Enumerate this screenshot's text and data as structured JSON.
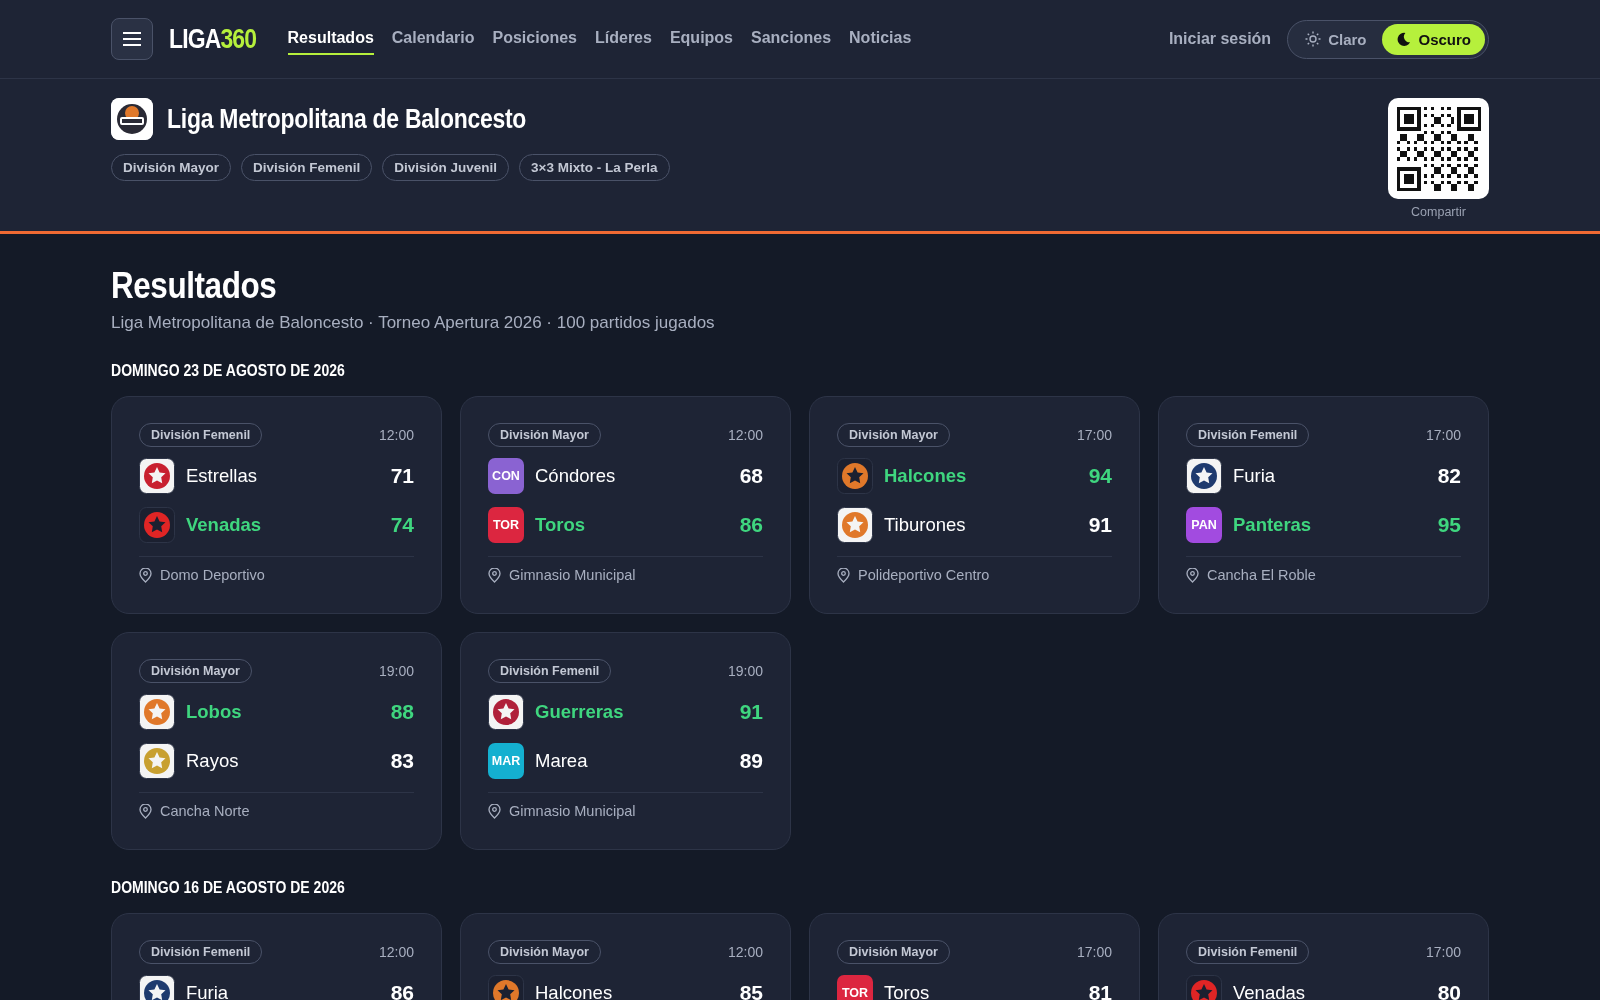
{
  "nav": {
    "brand": {
      "main": "LIGA",
      "accent": "360"
    },
    "links": [
      {
        "label": "Resultados",
        "selected": true
      },
      {
        "label": "Calendario",
        "selected": false
      },
      {
        "label": "Posiciones",
        "selected": false
      },
      {
        "label": "Líderes",
        "selected": false
      },
      {
        "label": "Equipos",
        "selected": false
      },
      {
        "label": "Sanciones",
        "selected": false
      },
      {
        "label": "Noticias",
        "selected": false
      }
    ],
    "login": "Iniciar sesión",
    "theme": [
      {
        "label": "Claro",
        "kind": "sun",
        "selected": false
      },
      {
        "label": "Oscuro",
        "kind": "moon",
        "selected": true
      }
    ]
  },
  "league": {
    "name": "Liga Metropolitana de Baloncesto",
    "divisions": [
      "División Mayor",
      "División Femenil",
      "División Juvenil",
      "3×3 Mixto - La Perla"
    ],
    "share": "Compartir"
  },
  "page": {
    "title": "Resultados",
    "subtitle": "Liga Metropolitana de Baloncesto · Torneo Apertura 2026 · 100 partidos jugados"
  },
  "days": [
    {
      "date": "DOMINGO 23 DE AGOSTO DE 2026",
      "matches": [
        {
          "division": "División Femenil",
          "time": "12:00",
          "venue": "Domo Deportivo",
          "teams": [
            {
              "name": "Estrellas",
              "score": "71",
              "winner": false,
              "logo": {
                "kind": "emblem",
                "color": "#c8202f",
                "light": true
              }
            },
            {
              "name": "Venadas",
              "score": "74",
              "winner": true,
              "logo": {
                "kind": "emblem",
                "color": "#e02525",
                "light": false
              }
            }
          ]
        },
        {
          "division": "División Mayor",
          "time": "12:00",
          "venue": "Gimnasio Municipal",
          "teams": [
            {
              "name": "Cóndores",
              "score": "68",
              "winner": false,
              "logo": {
                "kind": "abbr",
                "text": "CON",
                "color": "#8a63d2"
              }
            },
            {
              "name": "Toros",
              "score": "86",
              "winner": true,
              "logo": {
                "kind": "abbr",
                "text": "TOR",
                "color": "#dc2640"
              }
            }
          ]
        },
        {
          "division": "División Mayor",
          "time": "17:00",
          "venue": "Polideportivo Centro",
          "teams": [
            {
              "name": "Halcones",
              "score": "94",
              "winner": true,
              "logo": {
                "kind": "emblem",
                "color": "#e0782a",
                "light": false
              }
            },
            {
              "name": "Tiburones",
              "score": "91",
              "winner": false,
              "logo": {
                "kind": "emblem",
                "color": "#e0782a",
                "light": true
              }
            }
          ]
        },
        {
          "division": "División Femenil",
          "time": "17:00",
          "venue": "Cancha El Roble",
          "teams": [
            {
              "name": "Furia",
              "score": "82",
              "winner": false,
              "logo": {
                "kind": "emblem",
                "color": "#1e3a6e",
                "light": true
              }
            },
            {
              "name": "Panteras",
              "score": "95",
              "winner": true,
              "logo": {
                "kind": "abbr",
                "text": "PAN",
                "color": "#a24be0"
              }
            }
          ]
        },
        {
          "division": "División Mayor",
          "time": "19:00",
          "venue": "Cancha Norte",
          "teams": [
            {
              "name": "Lobos",
              "score": "88",
              "winner": true,
              "logo": {
                "kind": "emblem",
                "color": "#e0782a",
                "light": true
              }
            },
            {
              "name": "Rayos",
              "score": "83",
              "winner": false,
              "logo": {
                "kind": "emblem",
                "color": "#c8a030",
                "light": true
              }
            }
          ]
        },
        {
          "division": "División Femenil",
          "time": "19:00",
          "venue": "Gimnasio Municipal",
          "teams": [
            {
              "name": "Guerreras",
              "score": "91",
              "winner": true,
              "logo": {
                "kind": "emblem",
                "color": "#b0203a",
                "light": true
              }
            },
            {
              "name": "Marea",
              "score": "89",
              "winner": false,
              "logo": {
                "kind": "abbr",
                "text": "MAR",
                "color": "#14b0d0"
              }
            }
          ]
        }
      ]
    },
    {
      "date": "DOMINGO 16 DE AGOSTO DE 2026",
      "matches": [
        {
          "division": "División Femenil",
          "time": "12:00",
          "teams": [
            {
              "name": "Furia",
              "score": "86",
              "winner": false,
              "logo": {
                "kind": "emblem",
                "color": "#1e3a6e",
                "light": true
              }
            }
          ]
        },
        {
          "division": "División Mayor",
          "time": "12:00",
          "teams": [
            {
              "name": "Halcones",
              "score": "85",
              "winner": false,
              "logo": {
                "kind": "emblem",
                "color": "#e0782a",
                "light": false
              }
            }
          ]
        },
        {
          "division": "División Mayor",
          "time": "17:00",
          "teams": [
            {
              "name": "Toros",
              "score": "81",
              "winner": false,
              "logo": {
                "kind": "abbr",
                "text": "TOR",
                "color": "#dc2640"
              }
            }
          ]
        },
        {
          "division": "División Femenil",
          "time": "17:00",
          "teams": [
            {
              "name": "Venadas",
              "score": "80",
              "winner": false,
              "logo": {
                "kind": "emblem",
                "color": "#e02525",
                "light": false
              }
            }
          ]
        }
      ]
    }
  ]
}
